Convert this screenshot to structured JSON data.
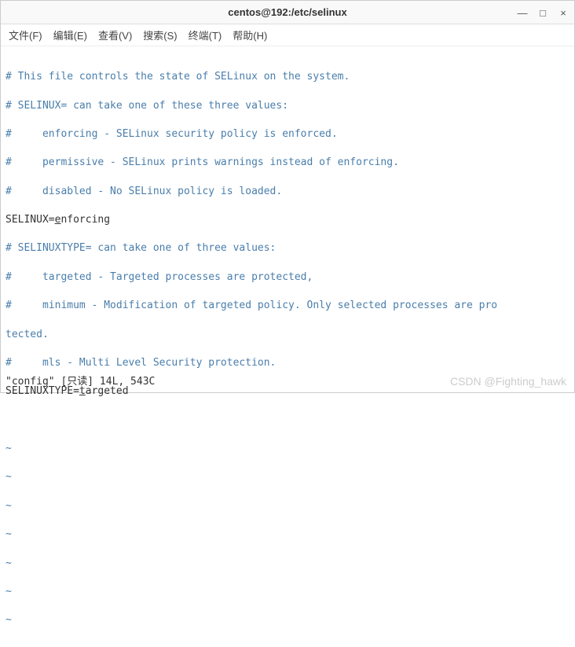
{
  "window": {
    "title": "centos@192:/etc/selinux"
  },
  "menu": {
    "file": "文件(F)",
    "edit": "编辑(E)",
    "view": "查看(V)",
    "search": "搜索(S)",
    "terminal": "终端(T)",
    "help": "帮助(H)"
  },
  "lines": {
    "l1": "# This file controls the state of SELinux on the system.",
    "l2": "# SELINUX= can take one of these three values:",
    "l3": "#     enforcing - SELinux security policy is enforced.",
    "l4": "#     permissive - SELinux prints warnings instead of enforcing.",
    "l5": "#     disabled - No SELinux policy is loaded.",
    "l6_key": "SELINUX=",
    "l6_cursor": "e",
    "l6_rest": "nforcing",
    "l7": "# SELINUXTYPE= can take one of three values:",
    "l8": "#     targeted - Targeted processes are protected,",
    "l9": "#     minimum - Modification of targeted policy. Only selected processes are pro",
    "l10": "tected.",
    "l11": "#     mls - Multi Level Security protection.",
    "l12_key": "SELINUXTYPE=",
    "l12_cursor": "t",
    "l12_rest": "argeted",
    "tilde": "~"
  },
  "status": "\"config\" [只读] 14L, 543C",
  "watermark": "CSDN @Fighting_hawk"
}
